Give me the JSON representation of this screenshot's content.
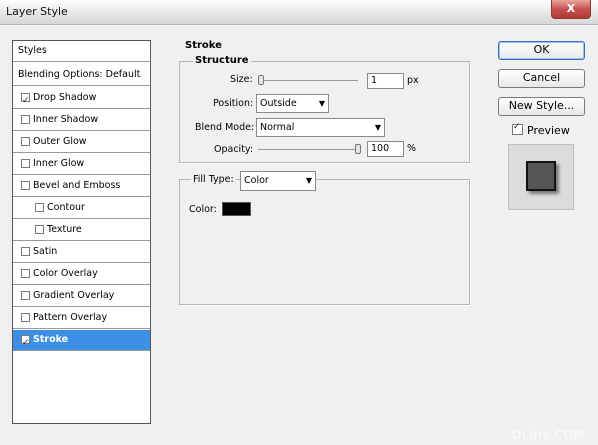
{
  "window": {
    "title": "Layer Style",
    "close_label": "X"
  },
  "styles_panel": {
    "header": "Styles",
    "blending": "Blending Options: Default",
    "items": [
      {
        "label": "Drop Shadow",
        "checked": true,
        "selected": false
      },
      {
        "label": "Inner Shadow",
        "checked": false,
        "selected": false
      },
      {
        "label": "Outer Glow",
        "checked": false,
        "selected": false
      },
      {
        "label": "Inner Glow",
        "checked": false,
        "selected": false
      },
      {
        "label": "Bevel and Emboss",
        "checked": false,
        "selected": false
      },
      {
        "label": "Contour",
        "checked": false,
        "selected": false
      },
      {
        "label": "Texture",
        "checked": false,
        "selected": false
      },
      {
        "label": "Satin",
        "checked": false,
        "selected": false
      },
      {
        "label": "Color Overlay",
        "checked": false,
        "selected": false
      },
      {
        "label": "Gradient Overlay",
        "checked": false,
        "selected": false
      },
      {
        "label": "Pattern Overlay",
        "checked": false,
        "selected": false
      },
      {
        "label": "Stroke",
        "checked": true,
        "selected": true
      }
    ]
  },
  "stroke": {
    "section_title": "Stroke",
    "structure_title": "Structure",
    "size_label": "Size:",
    "size_value": "1",
    "size_unit": "px",
    "size_fraction": 0.0,
    "position_label": "Position:",
    "position_value": "Outside",
    "blend_mode_label": "Blend Mode:",
    "blend_mode_value": "Normal",
    "opacity_label": "Opacity:",
    "opacity_value": "100",
    "opacity_unit": "%",
    "opacity_fraction": 1.0,
    "fill_type_label": "Fill Type:",
    "fill_type_value": "Color",
    "color_label": "Color:",
    "color_hex": "#000000"
  },
  "buttons": {
    "ok": "OK",
    "cancel": "Cancel",
    "new_style": "New Style...",
    "preview_label": "Preview",
    "preview_checked": true
  },
  "watermark": "OLiHe.COM",
  "colors": {
    "selection": "#3d8ee5",
    "preview_fill": "#555555"
  }
}
